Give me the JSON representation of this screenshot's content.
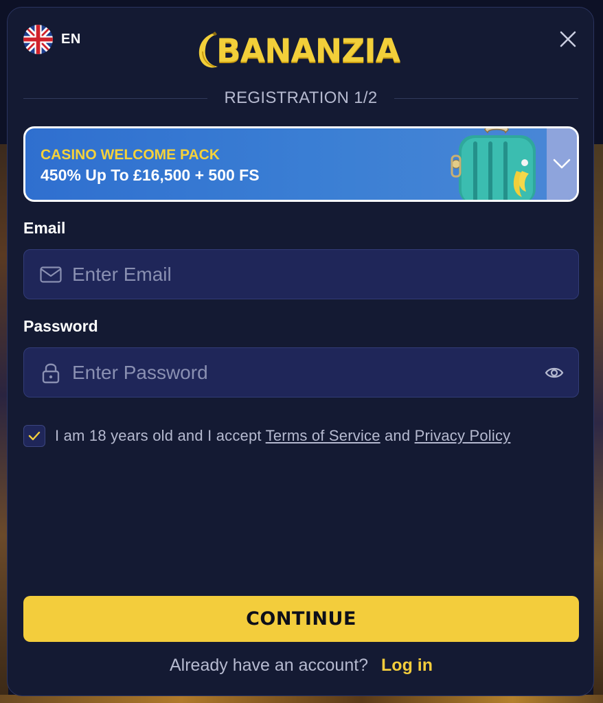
{
  "header": {
    "language": "EN",
    "logo_text": "BANANZIA",
    "close_icon": "close-icon",
    "flag_icon": "uk-flag-icon"
  },
  "step": {
    "title": "REGISTRATION 1/2"
  },
  "promo": {
    "title": "CASINO WELCOME PACK",
    "offer": "450% Up To £16,500 + 500 FS",
    "toggle_icon": "chevron-down-icon"
  },
  "form": {
    "email": {
      "label": "Email",
      "placeholder": "Enter Email",
      "icon": "envelope-icon"
    },
    "password": {
      "label": "Password",
      "placeholder": "Enter Password",
      "icon": "lock-icon",
      "toggle_icon": "eye-icon"
    },
    "consent": {
      "checked": true,
      "text_prefix": "I am 18 years old and I accept",
      "terms_link": "Terms of Service",
      "conjunction": "and",
      "privacy_link": "Privacy Policy"
    },
    "continue_label": "CONTINUE"
  },
  "footer": {
    "question": "Already have an account?",
    "login_link": "Log in"
  },
  "colors": {
    "modal_bg": "#141a33",
    "accent_yellow": "#f3cd3c",
    "field_bg": "#1f2659",
    "promo_blue": "#3b7fd4"
  }
}
